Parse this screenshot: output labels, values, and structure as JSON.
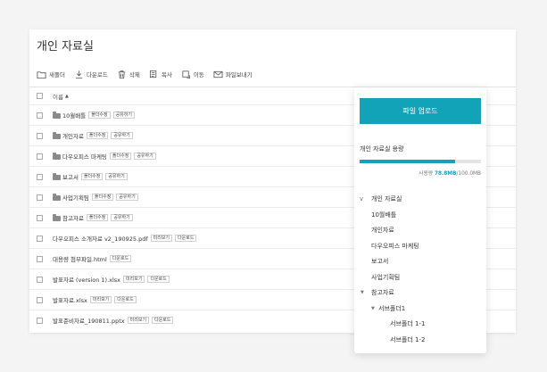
{
  "page": {
    "title": "개인 자료실"
  },
  "toolbar": [
    {
      "name": "new-folder-button",
      "icon": "new-folder-icon",
      "label": "새폴더"
    },
    {
      "name": "download-button",
      "icon": "download-icon",
      "label": "다운로드"
    },
    {
      "name": "delete-button",
      "icon": "trash-icon",
      "label": "삭제"
    },
    {
      "name": "copy-button",
      "icon": "copy-icon",
      "label": "복사"
    },
    {
      "name": "move-button",
      "icon": "move-icon",
      "label": "이동"
    },
    {
      "name": "send-file-button",
      "icon": "mail-icon",
      "label": "파일보내기"
    }
  ],
  "list": {
    "header_label": "이름",
    "sort_indicator": "▲",
    "rows": [
      {
        "type": "folder",
        "name": "10월배틀",
        "actions": [
          "폴더수정",
          "공유하기"
        ]
      },
      {
        "type": "folder",
        "name": "개인자료",
        "actions": [
          "폴더수정",
          "공유하기"
        ]
      },
      {
        "type": "folder",
        "name": "다우오피스 마케팅",
        "actions": [
          "폴더수정",
          "공유하기"
        ]
      },
      {
        "type": "folder",
        "name": "보고서",
        "actions": [
          "폴더수정",
          "공유하기"
        ]
      },
      {
        "type": "folder",
        "name": "사업기획팀",
        "actions": [
          "폴더수정",
          "공유하기"
        ]
      },
      {
        "type": "folder",
        "name": "참고자료",
        "actions": [
          "폴더수정",
          "공유하기"
        ]
      },
      {
        "type": "file",
        "name": "다우오피스 소개자료 v2_190925.pdf",
        "actions": [
          "미리보기",
          "다운로드"
        ]
      },
      {
        "type": "file",
        "name": "대용량 첨부파일.html",
        "actions": [
          "다운로드"
        ]
      },
      {
        "type": "file",
        "name": "발표자료 (version 1).xlsx",
        "actions": [
          "미리보기",
          "다운로드"
        ]
      },
      {
        "type": "file",
        "name": "발표자료.xlsx",
        "actions": [
          "미리보기",
          "다운로드"
        ]
      },
      {
        "type": "file",
        "name": "발표준비자료_190811.pptx",
        "actions": [
          "미리보기",
          "다운로드"
        ]
      }
    ]
  },
  "panel": {
    "upload_label": "파일 업로드",
    "usage_label": "개인 자료실 용량",
    "usage_prefix": "사용량 ",
    "usage_used": "78.8MB",
    "usage_total": "/100.0MB",
    "usage_fraction": 0.788,
    "accent": "#13a3b9",
    "tree": [
      {
        "label": "개인 자료실",
        "level": 0,
        "arrow": "v"
      },
      {
        "label": "10월배틀",
        "level": 1,
        "arrow": ""
      },
      {
        "label": "개인자료",
        "level": 1,
        "arrow": ""
      },
      {
        "label": "다우오피스 마케팅",
        "level": 1,
        "arrow": ""
      },
      {
        "label": "보고서",
        "level": 1,
        "arrow": ""
      },
      {
        "label": "사업기획팀",
        "level": 1,
        "arrow": ""
      },
      {
        "label": "참고자료",
        "level": 1,
        "arrow": "▼"
      },
      {
        "label": "서브폴더1",
        "level": 2,
        "arrow": "▼"
      },
      {
        "label": "서브폴더 1-1",
        "level": 3,
        "arrow": ""
      },
      {
        "label": "서브폴더 1-2",
        "level": 3,
        "arrow": ""
      }
    ]
  }
}
